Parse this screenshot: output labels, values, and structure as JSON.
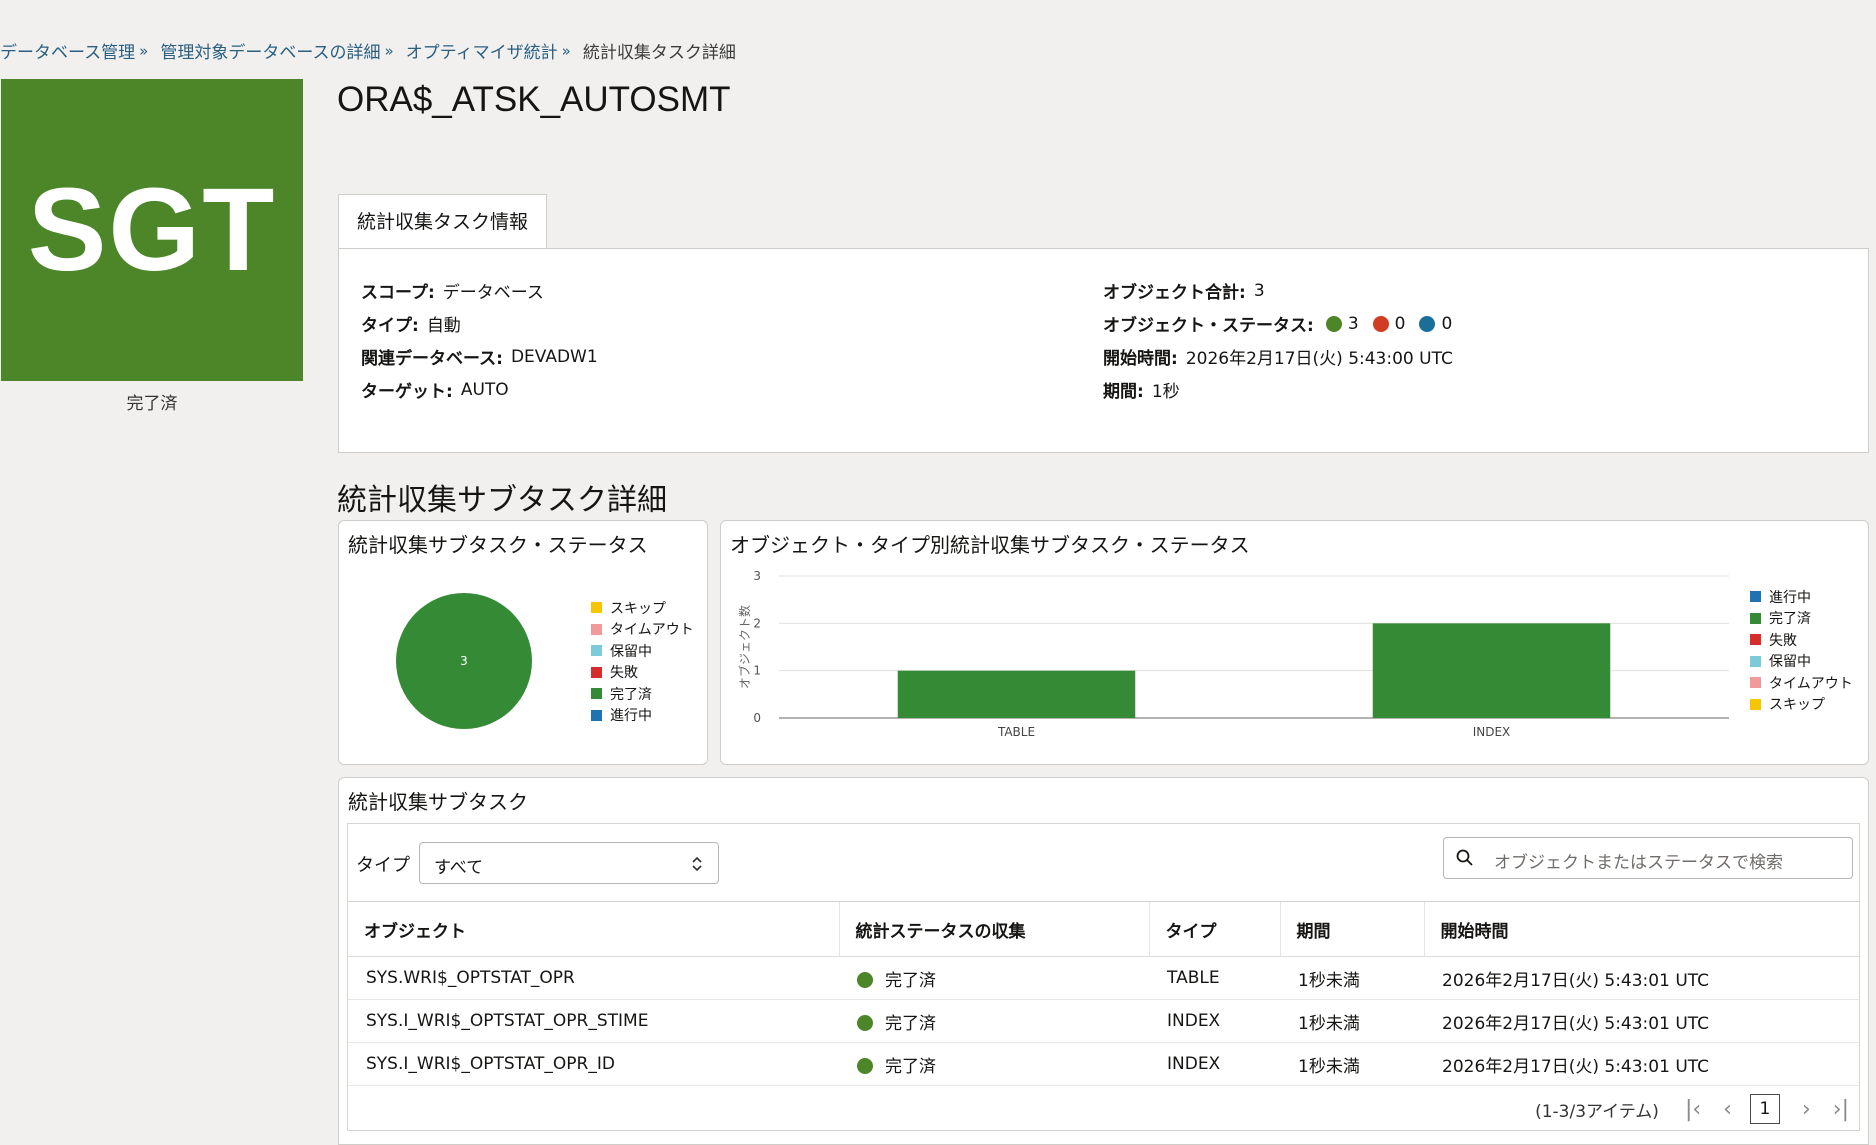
{
  "breadcrumb": {
    "items": [
      "データベース管理",
      "管理対象データベースの詳細",
      "オプティマイザ統計"
    ],
    "current": "統計収集タスク詳細"
  },
  "tile": {
    "text": "SGT",
    "caption": "完了済",
    "color": "#4d8628"
  },
  "title": "ORA$_ATSK_AUTOSMT",
  "info_tab": {
    "label": "統計収集タスク情報"
  },
  "info": {
    "scope": {
      "label": "スコープ:",
      "value": "データベース"
    },
    "type": {
      "label": "タイプ:",
      "value": "自動"
    },
    "database": {
      "label": "関連データベース:",
      "value": "DEVADW1"
    },
    "target": {
      "label": "ターゲット:",
      "value": "AUTO"
    },
    "object_total": {
      "label": "オブジェクト合計:",
      "value": "3"
    },
    "object_status": {
      "label": "オブジェクト・ステータス:",
      "items": [
        {
          "value": "3",
          "color": "#4d8628"
        },
        {
          "value": "0",
          "color": "#d03d22"
        },
        {
          "value": "0",
          "color": "#1a6f98"
        }
      ]
    },
    "start_time": {
      "label": "開始時間:",
      "value": "2026年2月17日(火) 5:43:00 UTC"
    },
    "duration": {
      "label": "期間:",
      "value": "1秒"
    }
  },
  "section_title": "統計収集サブタスク詳細",
  "pie_card": {
    "title": "統計収集サブタスク・ステータス",
    "legend": [
      {
        "label": "スキップ",
        "color": "#f7c600"
      },
      {
        "label": "タイムアウト",
        "color": "#f19a9c"
      },
      {
        "label": "保留中",
        "color": "#7ccbd9"
      },
      {
        "label": "失敗",
        "color": "#d62d2d"
      },
      {
        "label": "完了済",
        "color": "#358a36"
      },
      {
        "label": "進行中",
        "color": "#1f73b0"
      }
    ]
  },
  "bar_card": {
    "title": "オブジェクト・タイプ別統計収集サブタスク・ステータス",
    "legend": [
      {
        "label": "進行中",
        "color": "#1f73b0"
      },
      {
        "label": "完了済",
        "color": "#358a36"
      },
      {
        "label": "失敗",
        "color": "#d62d2d"
      },
      {
        "label": "保留中",
        "color": "#7ccbd9"
      },
      {
        "label": "タイムアウト",
        "color": "#f19a9c"
      },
      {
        "label": "スキップ",
        "color": "#f7c600"
      }
    ]
  },
  "chart_data": [
    {
      "type": "pie",
      "title": "統計収集サブタスク・ステータス",
      "slices": [
        {
          "name": "完了済",
          "value": 3,
          "color": "#358a36"
        }
      ],
      "slice_label": "3",
      "legend": [
        "スキップ",
        "タイムアウト",
        "保留中",
        "失敗",
        "完了済",
        "進行中"
      ],
      "legend_placement": "right"
    },
    {
      "type": "bar",
      "title": "オブジェクト・タイプ別統計収集サブタスク・ステータス",
      "categories": [
        "TABLE",
        "INDEX"
      ],
      "series": [
        {
          "name": "完了済",
          "values": [
            1,
            2
          ],
          "color": "#358a36"
        }
      ],
      "ylabel": "オブジェクト数",
      "ylim": [
        0,
        3
      ],
      "yticks": [
        "0",
        "1",
        "2",
        "3"
      ],
      "grid": true,
      "legend_placement": "right"
    }
  ],
  "subtask_card": {
    "title": "統計収集サブタスク",
    "filter_label": "タイプ",
    "filter_value": "すべて",
    "search_placeholder": "オブジェクトまたはステータスで検索",
    "columns": [
      "オブジェクト",
      "統計ステータスの収集",
      "タイプ",
      "期間",
      "開始時間"
    ],
    "rows": [
      {
        "object": "SYS.WRI$_OPTSTAT_OPR",
        "status": "完了済",
        "type": "TABLE",
        "duration": "1秒未満",
        "start": "2026年2月17日(火) 5:43:01 UTC"
      },
      {
        "object": "SYS.I_WRI$_OPTSTAT_OPR_STIME",
        "status": "完了済",
        "type": "INDEX",
        "duration": "1秒未満",
        "start": "2026年2月17日(火) 5:43:01 UTC"
      },
      {
        "object": "SYS.I_WRI$_OPTSTAT_OPR_ID",
        "status": "完了済",
        "type": "INDEX",
        "duration": "1秒未満",
        "start": "2026年2月17日(火) 5:43:01 UTC"
      }
    ],
    "pager": {
      "summary": "(1-3/3アイテム)",
      "page": "1"
    }
  }
}
